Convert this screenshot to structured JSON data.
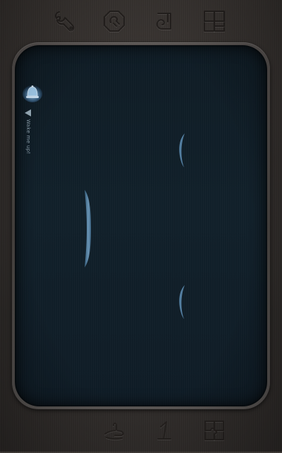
{
  "toolbar_top": {
    "buttons": [
      {
        "name": "wrench-button",
        "icon": "wrench-icon"
      },
      {
        "name": "stop-sign-button",
        "icon": "stop-sign-icon"
      },
      {
        "name": "spiral-button",
        "icon": "spiral-icon"
      },
      {
        "name": "layout-grid-button",
        "icon": "layout-grid-icon"
      }
    ]
  },
  "toolbar_bottom": {
    "buttons": [
      {
        "name": "hand-button",
        "icon": "hand-icon"
      },
      {
        "name": "number-one-button",
        "icon": "number-one-icon"
      },
      {
        "name": "puzzle-button",
        "icon": "puzzle-icon"
      }
    ]
  },
  "arena": {
    "wake_label": "Wake me up!",
    "bell_icon": "bell-icon",
    "arrow_icon": "arrow-left-icon"
  },
  "colors": {
    "metal_background": "#2f2b29",
    "bezel": "#4e4a47",
    "arena_background": "#11202a",
    "glow_blue": "#7fb6e6",
    "paddle_blue": "#5a86a8",
    "embossed_icon": "#25211f"
  }
}
